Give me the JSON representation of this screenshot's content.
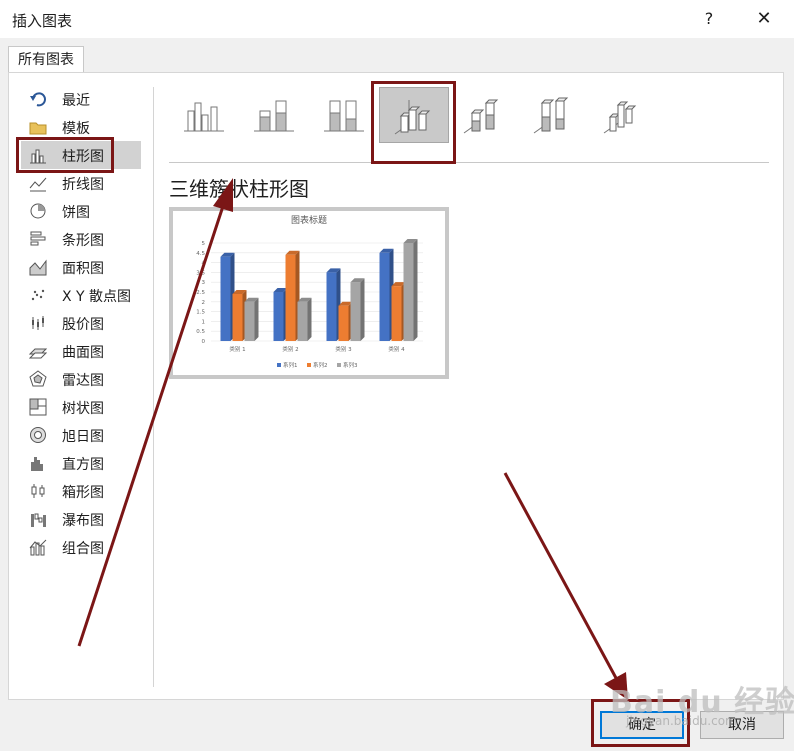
{
  "window": {
    "title": "插入图表",
    "help_label": "?",
    "close_label": "✕"
  },
  "tabs": [
    {
      "label": "所有图表"
    }
  ],
  "sidebar": {
    "items": [
      {
        "label": "最近",
        "icon": "undo-arrow-icon"
      },
      {
        "label": "模板",
        "icon": "folder-icon"
      },
      {
        "label": "柱形图",
        "icon": "column-chart-icon",
        "selected": true
      },
      {
        "label": "折线图",
        "icon": "line-chart-icon"
      },
      {
        "label": "饼图",
        "icon": "pie-chart-icon"
      },
      {
        "label": "条形图",
        "icon": "bar-chart-icon"
      },
      {
        "label": "面积图",
        "icon": "area-chart-icon"
      },
      {
        "label": "X Y 散点图",
        "icon": "scatter-chart-icon"
      },
      {
        "label": "股价图",
        "icon": "stock-chart-icon"
      },
      {
        "label": "曲面图",
        "icon": "surface-chart-icon"
      },
      {
        "label": "雷达图",
        "icon": "radar-chart-icon"
      },
      {
        "label": "树状图",
        "icon": "treemap-chart-icon"
      },
      {
        "label": "旭日图",
        "icon": "sunburst-chart-icon"
      },
      {
        "label": "直方图",
        "icon": "histogram-chart-icon"
      },
      {
        "label": "箱形图",
        "icon": "box-whisker-chart-icon"
      },
      {
        "label": "瀑布图",
        "icon": "waterfall-chart-icon"
      },
      {
        "label": "组合图",
        "icon": "combo-chart-icon"
      }
    ]
  },
  "subtypes": [
    {
      "icon": "clustered-column-icon"
    },
    {
      "icon": "stacked-column-icon"
    },
    {
      "icon": "stacked-100-column-icon"
    },
    {
      "icon": "3d-clustered-column-icon",
      "selected": true
    },
    {
      "icon": "3d-stacked-column-icon"
    },
    {
      "icon": "3d-stacked-100-column-icon"
    },
    {
      "icon": "3d-column-icon"
    }
  ],
  "selected_chart_name": "三维簇状柱形图",
  "preview": {
    "chart_data": {
      "type": "bar",
      "title": "图表标题",
      "categories": [
        "类别 1",
        "类别 2",
        "类别 3",
        "类别 4"
      ],
      "series": [
        {
          "name": "系列1",
          "values": [
            4.3,
            2.5,
            3.5,
            4.5
          ]
        },
        {
          "name": "系列2",
          "values": [
            2.4,
            4.4,
            1.8,
            2.8
          ]
        },
        {
          "name": "系列3",
          "values": [
            2.0,
            2.0,
            3.0,
            5.0
          ]
        }
      ],
      "ylim": [
        0,
        5
      ],
      "yticks": [
        "0",
        "0.5",
        "1",
        "1.5",
        "2",
        "2.5",
        "3",
        "3.5",
        "4",
        "4.5",
        "5"
      ],
      "legend": "bottom",
      "grid": true,
      "colors": [
        "#4472c4",
        "#ed7d31",
        "#a5a5a5"
      ]
    }
  },
  "footer": {
    "ok_label": "确定",
    "cancel_label": "取消"
  },
  "watermark": {
    "main": "Bai du 经验",
    "sub": "jingyan.baidu.com"
  },
  "annotation_color": "#7b1616"
}
